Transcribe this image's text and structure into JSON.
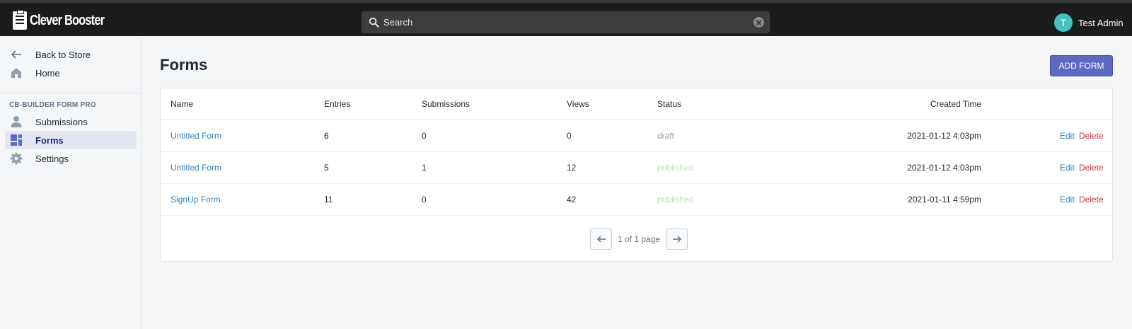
{
  "topbar": {
    "logo_text": "Clever Booster",
    "search_placeholder": "Search",
    "user_initial": "T",
    "user_name": "Test Admin"
  },
  "sidebar": {
    "back_label": "Back to Store",
    "home_label": "Home",
    "section_title": "CB-BUILDER FORM PRO",
    "items": [
      {
        "label": "Submissions",
        "icon": "person-icon",
        "active": false
      },
      {
        "label": "Forms",
        "icon": "dashboard-icon",
        "active": true
      },
      {
        "label": "Settings",
        "icon": "gear-icon",
        "active": false
      }
    ]
  },
  "main": {
    "title": "Forms",
    "add_button": "ADD FORM",
    "table": {
      "headers": {
        "name": "Name",
        "entries": "Entries",
        "submissions": "Submissions",
        "views": "Views",
        "status": "Status",
        "created": "Created Time"
      },
      "rows": [
        {
          "name": "Untitled Form",
          "entries": "6",
          "submissions": "0",
          "views": "0",
          "status": "draft",
          "created": "2021-01-12 4:03pm",
          "edit": "Edit",
          "delete": "Delete"
        },
        {
          "name": "Untitled Form",
          "entries": "5",
          "submissions": "1",
          "views": "12",
          "status": "published",
          "created": "2021-01-12 4:03pm",
          "edit": "Edit",
          "delete": "Delete"
        },
        {
          "name": "SignUp Form",
          "entries": "11",
          "submissions": "0",
          "views": "42",
          "status": "published",
          "created": "2021-01-11 4:59pm",
          "edit": "Edit",
          "delete": "Delete"
        }
      ]
    },
    "pagination": {
      "text": "1 of 1 page"
    }
  },
  "colors": {
    "topbar": "#1c1c1c",
    "accent": "#5c6ac4",
    "link": "#2e7fb7",
    "delete": "#c2313a",
    "avatar": "#47c1bf"
  }
}
